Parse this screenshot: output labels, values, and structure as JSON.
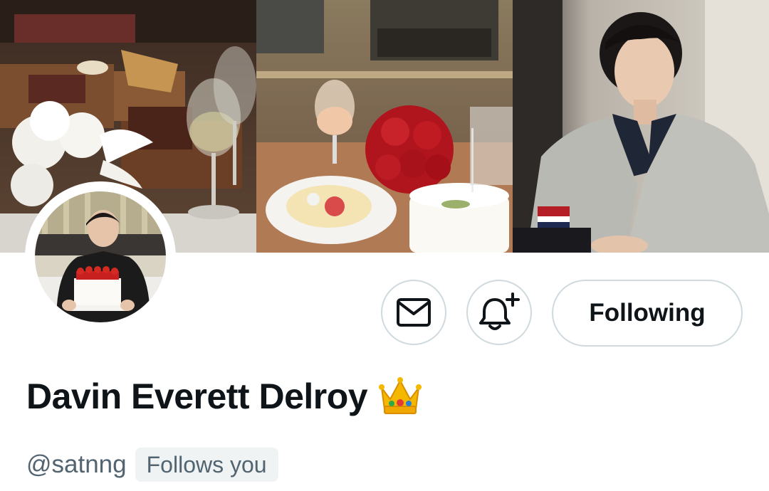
{
  "profile": {
    "display_name": "Davin Everett Delroy",
    "badge_emoji_name": "crown-emoji",
    "handle": "@satnng",
    "follows_you_label": "Follows you"
  },
  "actions": {
    "message_icon": "envelope-icon",
    "notify_icon": "bell-plus-icon",
    "follow_label": "Following"
  },
  "banner": {
    "panels": [
      "dinner-table-photo",
      "cake-and-roses-photo",
      "portrait-photo"
    ]
  },
  "colors": {
    "text_primary": "#0f1419",
    "text_secondary": "#536471",
    "border": "#cfd9de",
    "badge_bg": "#eff3f4"
  }
}
